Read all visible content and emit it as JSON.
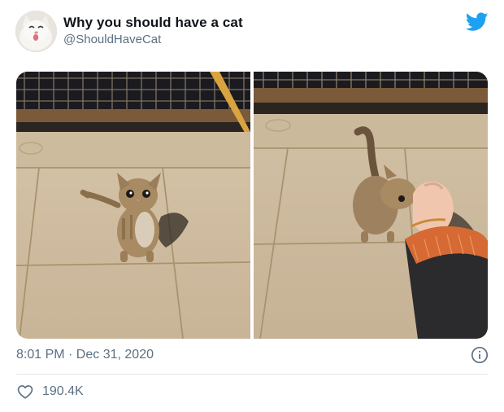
{
  "author": {
    "name": "Why you should have a cat",
    "handle": "@ShouldHaveCat"
  },
  "media": [
    {
      "description": "kitten sitting on sidewalk looking up"
    },
    {
      "description": "kitten rubbing against a hand on sidewalk"
    }
  ],
  "meta": {
    "timestamp": "8:01 PM · Dec 31, 2020",
    "likes": "190.4K"
  },
  "colors": {
    "twitter_blue": "#1da1f2",
    "secondary_text": "#5b7083",
    "divider": "#e1e8ed"
  },
  "icons": [
    "twitter-bird-icon",
    "info-icon",
    "heart-icon"
  ]
}
